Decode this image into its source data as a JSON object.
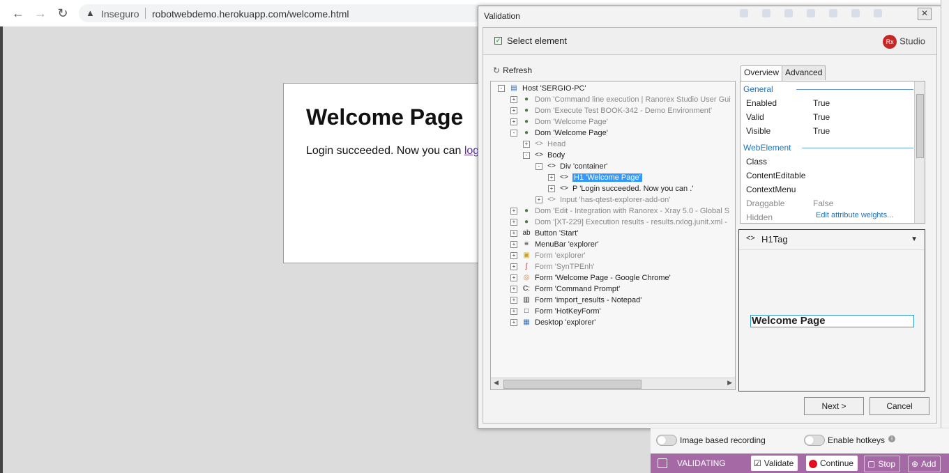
{
  "browser": {
    "security_label": "Inseguro",
    "url": "robotwebdemo.herokuapp.com/welcome.html"
  },
  "page": {
    "title": "Welcome Page",
    "text_prefix": "Login succeeded. Now you can ",
    "link_text": "log"
  },
  "dialog": {
    "title": "Validation",
    "header": "Select element",
    "logo_text": "Studio",
    "refresh_label": "Refresh",
    "tree": [
      {
        "label": "Host 'SERGIO-PC'",
        "dim": false,
        "icon": "computer-icon"
      },
      {
        "label": "Dom 'Command line execution | Ranorex Studio User Gui",
        "dim": true,
        "icon": "dom-icon"
      },
      {
        "label": "Dom 'Execute Test BOOK-342 - Demo Environment'",
        "dim": true,
        "icon": "dom-icon"
      },
      {
        "label": "Dom 'Welcome Page'",
        "dim": true,
        "icon": "dom-icon"
      },
      {
        "label": "Dom 'Welcome Page'",
        "dim": false,
        "icon": "dom-icon"
      },
      {
        "label": "Head",
        "dim": true,
        "icon": "tag-icon"
      },
      {
        "label": "Body",
        "dim": false,
        "icon": "tag-icon"
      },
      {
        "label": "Div 'container'",
        "dim": false,
        "icon": "tag-icon"
      },
      {
        "label": "H1 'Welcome Page'",
        "dim": false,
        "icon": "tag-icon",
        "selected": true
      },
      {
        "label": "P 'Login succeeded. Now you can .'",
        "dim": false,
        "icon": "tag-icon"
      },
      {
        "label": "Input 'has-qtest-explorer-add-on'",
        "dim": true,
        "icon": "tag-icon"
      },
      {
        "label": "Dom 'Edit - Integration with Ranorex - Xray 5.0 - Global S",
        "dim": true,
        "icon": "dom-icon"
      },
      {
        "label": "Dom '[XT-229] Execution results - results.rxlog.junit.xml -",
        "dim": true,
        "icon": "dom-icon"
      },
      {
        "label": "Button 'Start'",
        "dim": false,
        "icon": "button-icon"
      },
      {
        "label": "MenuBar 'explorer'",
        "dim": false,
        "icon": "menubar-icon"
      },
      {
        "label": "Form 'explorer'",
        "dim": true,
        "icon": "folder-icon"
      },
      {
        "label": "Form 'SynTPEnh'",
        "dim": true,
        "icon": "syntp-icon"
      },
      {
        "label": "Form 'Welcome Page - Google Chrome'",
        "dim": false,
        "icon": "chrome-icon"
      },
      {
        "label": "Form 'Command Prompt'",
        "dim": false,
        "icon": "cmd-icon"
      },
      {
        "label": "Form 'import_results - Notepad'",
        "dim": false,
        "icon": "notepad-icon"
      },
      {
        "label": "Form 'HotKeyForm'",
        "dim": false,
        "icon": "form-icon"
      },
      {
        "label": "Desktop 'explorer'",
        "dim": false,
        "icon": "desktop-icon"
      }
    ],
    "tabs": [
      "Overview",
      "Advanced"
    ],
    "props": {
      "general_label": "General",
      "webelement_label": "WebElement",
      "enabled_key": "Enabled",
      "enabled_val": "True",
      "valid_key": "Valid",
      "valid_val": "True",
      "visible_key": "Visible",
      "visible_val": "True",
      "class_key": "Class",
      "contenteditable_key": "ContentEditable",
      "contextmenu_key": "ContextMenu",
      "draggable_key": "Draggable",
      "draggable_val": "False",
      "hidden_key": "Hidden",
      "edit_weights": "Edit attribute weights..."
    },
    "preview": {
      "tag": "H1Tag",
      "text": "Welcome Page"
    },
    "next_label": "Next >",
    "cancel_label": "Cancel"
  },
  "recorder": {
    "image_based": "Image based recording",
    "hotkeys": "Enable hotkeys",
    "state": "VALIDATING",
    "validate": "Validate",
    "continue": "Continue",
    "stop": "Stop",
    "add": "Add"
  },
  "colors": {
    "accent": "#a56aa5",
    "selection": "#3399ff",
    "link": "#1e73be"
  }
}
